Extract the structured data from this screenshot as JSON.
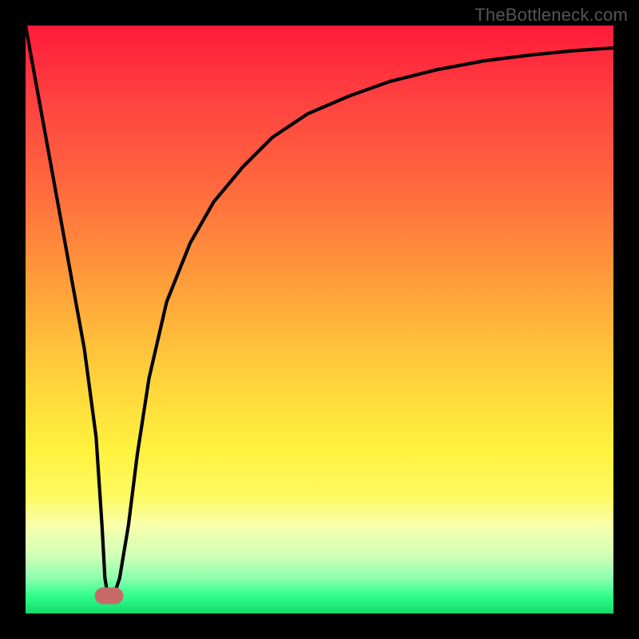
{
  "watermark": "TheBottleneck.com",
  "chart_data": {
    "type": "line",
    "title": "",
    "xlabel": "",
    "ylabel": "",
    "xlim": [
      0,
      100
    ],
    "ylim": [
      0,
      100
    ],
    "x": [
      0,
      2,
      4,
      6,
      8,
      10,
      12,
      13,
      13.5,
      14,
      14.5,
      15,
      16,
      17.5,
      19,
      21,
      24,
      28,
      32,
      37,
      42,
      48,
      55,
      62,
      70,
      78,
      86,
      93,
      100
    ],
    "values": [
      100,
      89,
      78,
      67,
      56,
      45,
      30,
      15,
      6,
      3,
      3,
      3,
      6,
      15,
      27,
      40,
      53,
      63,
      70,
      76,
      81,
      85,
      88,
      90.5,
      92.5,
      94,
      95,
      95.7,
      96.2
    ],
    "annotations": [
      {
        "type": "marker",
        "x_range": [
          13.2,
          15.2
        ],
        "y": 3,
        "color": "#c76a68"
      }
    ],
    "background_gradient": [
      {
        "stop": 0,
        "color": "#ff1a3a"
      },
      {
        "stop": 28,
        "color": "#ff6a3e"
      },
      {
        "stop": 60,
        "color": "#ffd23b"
      },
      {
        "stop": 80,
        "color": "#fdfa60"
      },
      {
        "stop": 94,
        "color": "#8dffad"
      },
      {
        "stop": 100,
        "color": "#14da6c"
      }
    ]
  }
}
